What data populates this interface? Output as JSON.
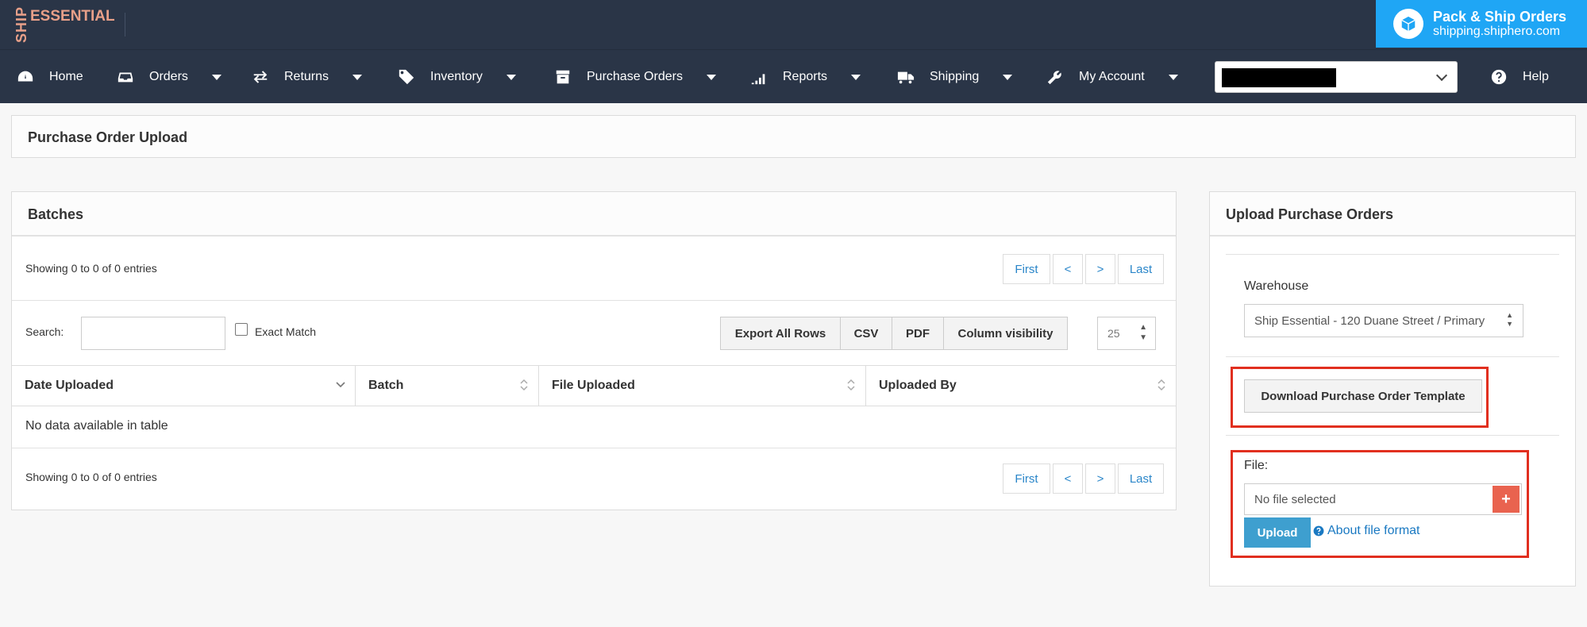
{
  "brand": {
    "logo_vertical": "SHIP",
    "logo_main": "ESSENTIAL"
  },
  "promo": {
    "title": "Pack & Ship Orders",
    "subtitle": "shipping.shiphero.com",
    "icon": "box-icon"
  },
  "nav": {
    "items": [
      {
        "label": "Home",
        "icon": "dashboard-icon"
      },
      {
        "label": "Orders",
        "icon": "inbox-icon"
      },
      {
        "label": "Returns",
        "icon": "exchange-icon"
      },
      {
        "label": "Inventory",
        "icon": "tags-icon"
      },
      {
        "label": "Purchase Orders",
        "icon": "archive-icon"
      },
      {
        "label": "Reports",
        "icon": "signal-icon"
      },
      {
        "label": "Shipping",
        "icon": "truck-icon"
      },
      {
        "label": "My Account",
        "icon": "wrench-icon"
      }
    ],
    "help_label": "Help"
  },
  "page": {
    "title": "Purchase Order Upload"
  },
  "batches": {
    "title": "Batches",
    "info_top": "Showing 0 to 0 of 0 entries",
    "info_bottom": "Showing 0 to 0 of 0 entries",
    "pager": {
      "first": "First",
      "prev": "<",
      "next": ">",
      "last": "Last"
    },
    "search_label": "Search:",
    "exact_match_label": "Exact Match",
    "buttons": [
      "Export All Rows",
      "CSV",
      "PDF",
      "Column visibility"
    ],
    "page_size": "25",
    "columns": [
      "Date Uploaded",
      "Batch",
      "File Uploaded",
      "Uploaded By"
    ],
    "empty_message": "No data available in table"
  },
  "upload": {
    "title": "Upload Purchase Orders",
    "warehouse_label": "Warehouse",
    "warehouse_value": "Ship Essential - 120 Duane Street / Primary",
    "download_template_label": "Download Purchase Order Template",
    "file_label": "File:",
    "file_placeholder": "No file selected",
    "plus_label": "+",
    "upload_button": "Upload",
    "about_link": "About file format"
  },
  "colors": {
    "header_bg": "#2a3547",
    "promo_bg": "#1fa6f5",
    "link": "#2a86c9",
    "highlight": "#e12f1f",
    "upload_btn": "#3e9fcf"
  }
}
